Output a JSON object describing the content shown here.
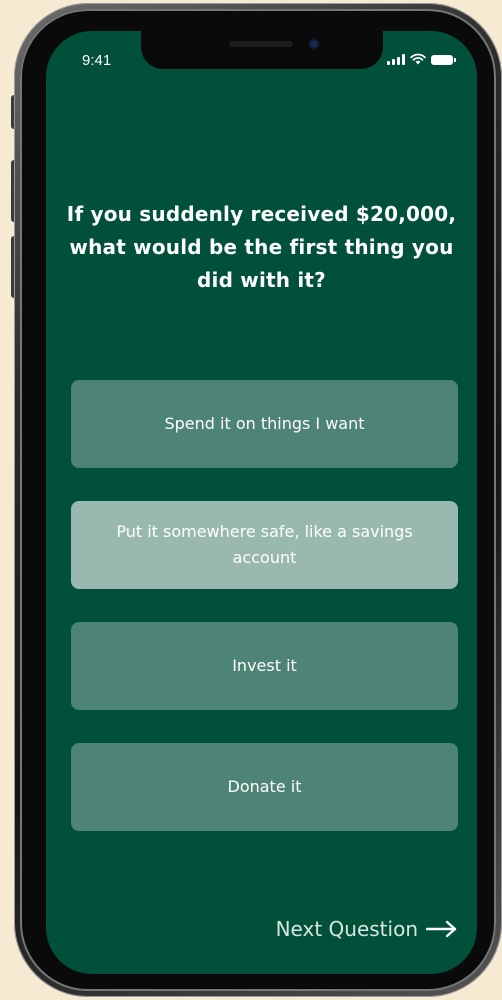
{
  "status_bar": {
    "time": "9:41",
    "icons": [
      "signal-icon",
      "wifi-icon",
      "battery-icon"
    ]
  },
  "quiz": {
    "question": "If you suddenly received $20,000, what would be the first thing you did with it?",
    "options": [
      {
        "label": "Spend it on things I want",
        "selected": false
      },
      {
        "label": "Put it somewhere safe, like a savings account",
        "selected": true
      },
      {
        "label": "Invest it",
        "selected": false
      },
      {
        "label": "Donate it",
        "selected": false
      }
    ],
    "next_label": "Next Question",
    "next_icon": "arrow-right-icon"
  },
  "colors": {
    "background": "#f6ead2",
    "screen": "#00503a",
    "text": "#ffffff"
  }
}
